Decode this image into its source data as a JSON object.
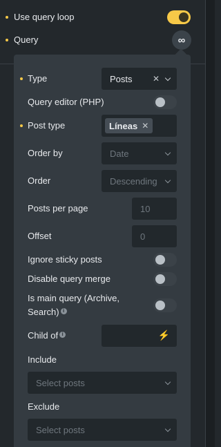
{
  "top": {
    "use_query_loop": "Use query loop",
    "query": "Query",
    "query_icon": "infinity-icon"
  },
  "popup": {
    "type": {
      "label": "Type",
      "value": "Posts"
    },
    "query_editor": {
      "label": "Query editor (PHP)"
    },
    "post_type": {
      "label": "Post type",
      "tag": "Líneas"
    },
    "order_by": {
      "label": "Order by",
      "value": "Date"
    },
    "order": {
      "label": "Order",
      "value": "Descending"
    },
    "posts_per_page": {
      "label": "Posts per page",
      "placeholder": "10"
    },
    "offset": {
      "label": "Offset",
      "placeholder": "0"
    },
    "ignore_sticky": {
      "label": "Ignore sticky posts"
    },
    "disable_merge": {
      "label": "Disable query merge"
    },
    "is_main_query": {
      "label_line1": "Is main query (Archive,",
      "label_line2": "Search)"
    },
    "child_of": {
      "label": "Child of"
    },
    "include": {
      "label": "Include",
      "placeholder": "Select posts"
    },
    "exclude": {
      "label": "Exclude",
      "placeholder": "Select posts"
    }
  },
  "colors": {
    "accent": "#f7c948",
    "panel": "#343b41",
    "background": "#23282c"
  }
}
